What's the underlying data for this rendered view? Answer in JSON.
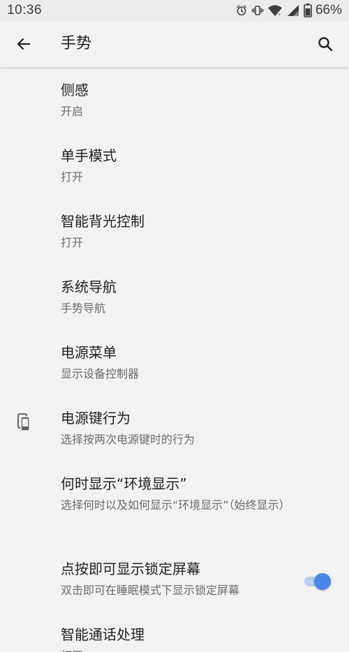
{
  "status_bar": {
    "time": "10:36",
    "battery_percent": "66%",
    "icons": [
      "alarm-icon",
      "vibrate-icon",
      "wifi-icon",
      "signal-icon",
      "battery-icon"
    ]
  },
  "app_bar": {
    "title": "手势",
    "back_icon": "arrow-back-icon",
    "search_icon": "search-icon"
  },
  "settings": [
    {
      "title": "侧感",
      "summary": "开启"
    },
    {
      "title": "单手模式",
      "summary": "打开"
    },
    {
      "title": "智能背光控制",
      "summary": "打开"
    },
    {
      "title": "系统导航",
      "summary": "手势导航"
    },
    {
      "title": "电源菜单",
      "summary": "显示设备控制器"
    },
    {
      "title": "电源键行为",
      "summary": "选择按两次电源键时的行为",
      "icon": "phone-double-press-icon"
    },
    {
      "title": "何时显示“环境显示”",
      "summary": "选择何时以及如何显示“环境显示”（始终显示）"
    },
    {
      "title": "点按即可显示锁定屏幕",
      "summary": "双击即可在睡眠模式下显示锁定屏幕",
      "toggle": true
    },
    {
      "title": "智能通话处理",
      "summary": "打开"
    }
  ],
  "colors": {
    "accent": "#4a86e8",
    "toggle_track": "#b8cdf5",
    "background": "#f2f2f2"
  }
}
